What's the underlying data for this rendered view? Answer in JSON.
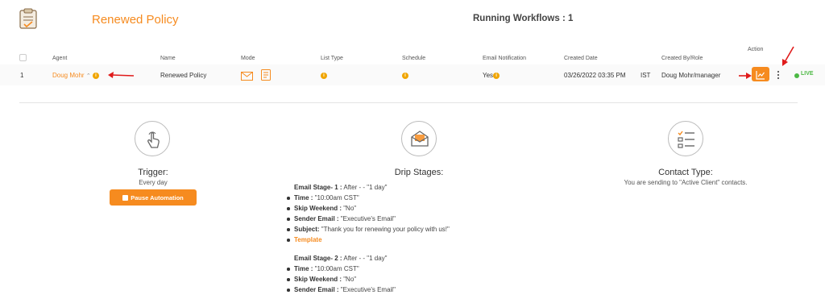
{
  "header": {
    "title": "Renewed Policy",
    "running_workflows": "Running Workflows : 1"
  },
  "table": {
    "action_header": "Action",
    "columns": [
      "Agent",
      "Name",
      "Mode",
      "List Type",
      "Schedule",
      "Email Notification",
      "Created Date",
      "Created By/Role"
    ],
    "row": {
      "index": "1",
      "agent": "Doug Mohr",
      "name": "Renewed Policy",
      "email_notification": "Yes",
      "created_date": "03/26/2022 03:35 PM",
      "timezone": "IST",
      "created_by": "Doug Mohr/manager",
      "status": "LIVE"
    }
  },
  "trigger": {
    "title": "Trigger:",
    "subtitle": "Every day",
    "pause_label": "Pause Automation"
  },
  "drip": {
    "title": "Drip Stages:",
    "stage1": {
      "label": "Email Stage- 1 :",
      "after": " After - - \"1 day\"",
      "time_label": "Time :",
      "time": " \"10:00am CST\"",
      "skip_label": "Skip Weekend :",
      "skip": " \"No\"",
      "sender_label": "Sender Email :",
      "sender": " \"Executive's Email\"",
      "subject_label": "Subject:",
      "subject": " \"Thank you for renewing your policy with us!\"",
      "template": "Template"
    },
    "stage2": {
      "label": "Email Stage- 2 :",
      "after": " After - - \"1 day\"",
      "time_label": "Time :",
      "time": " \"10:00am CST\"",
      "skip_label": "Skip Weekend :",
      "skip": " \"No\"",
      "sender_label": "Sender Email :",
      "sender": " \"Executive's Email\""
    }
  },
  "contact": {
    "title": "Contact Type:",
    "subtitle": "You are sending to \"Active Client\" contacts."
  },
  "colors": {
    "accent": "#f68b1f",
    "live": "#4cb944",
    "annotation": "#e01b1b"
  },
  "icons": [
    "clipboard-logo-icon",
    "info-icon",
    "envelope-icon",
    "list-type-icon",
    "chevron-up-icon",
    "chart-icon",
    "kebab-icon",
    "touch-icon",
    "open-envelope-icon",
    "checklist-icon",
    "annotation-arrow"
  ]
}
